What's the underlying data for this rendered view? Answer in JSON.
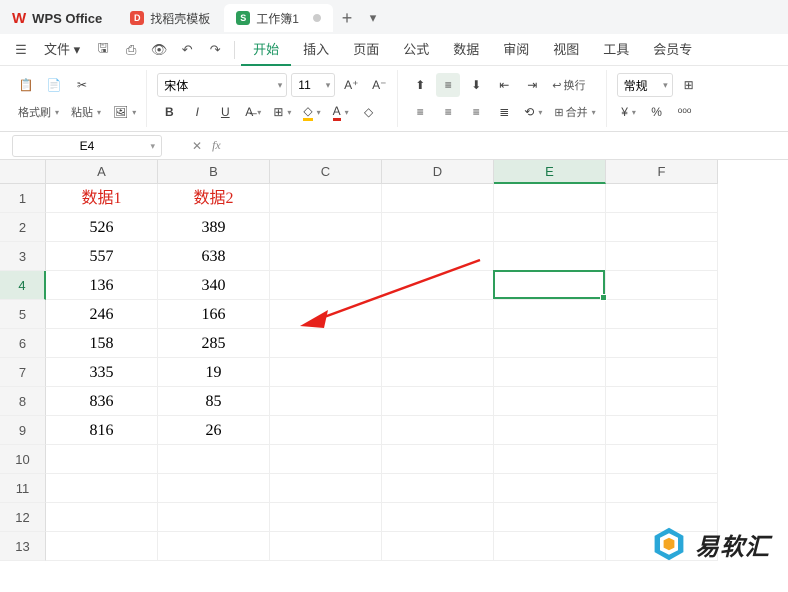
{
  "app": {
    "name": "WPS Office"
  },
  "tabs": [
    {
      "label": "找稻壳模板",
      "icon_bg": "#e84c3d",
      "icon_text": "D"
    },
    {
      "label": "工作簿1",
      "icon_bg": "#2e9e5b",
      "icon_text": "S",
      "active": true
    }
  ],
  "menubar": {
    "file": "文件",
    "items": [
      "开始",
      "插入",
      "页面",
      "公式",
      "数据",
      "审阅",
      "视图",
      "工具",
      "会员专"
    ],
    "active": "开始"
  },
  "toolbar": {
    "format_painter": "格式刷",
    "paste": "粘贴",
    "font_name": "宋体",
    "font_size": "11",
    "bold": "B",
    "italic": "I",
    "underline": "U",
    "wrap": "换行",
    "merge": "合并",
    "number_format": "常规"
  },
  "namebox": "E4",
  "formula": "",
  "columns": [
    "A",
    "B",
    "C",
    "D",
    "E",
    "F"
  ],
  "rows": [
    1,
    2,
    3,
    4,
    5,
    6,
    7,
    8,
    9,
    10,
    11,
    12,
    13
  ],
  "selected_col": "E",
  "selected_row": 4,
  "table": {
    "headers": [
      "数据1",
      "数据2"
    ],
    "data": [
      [
        526,
        389
      ],
      [
        557,
        638
      ],
      [
        136,
        340
      ],
      [
        246,
        166
      ],
      [
        158,
        285
      ],
      [
        335,
        19
      ],
      [
        836,
        85
      ],
      [
        816,
        26
      ]
    ]
  },
  "watermark": "易软汇"
}
